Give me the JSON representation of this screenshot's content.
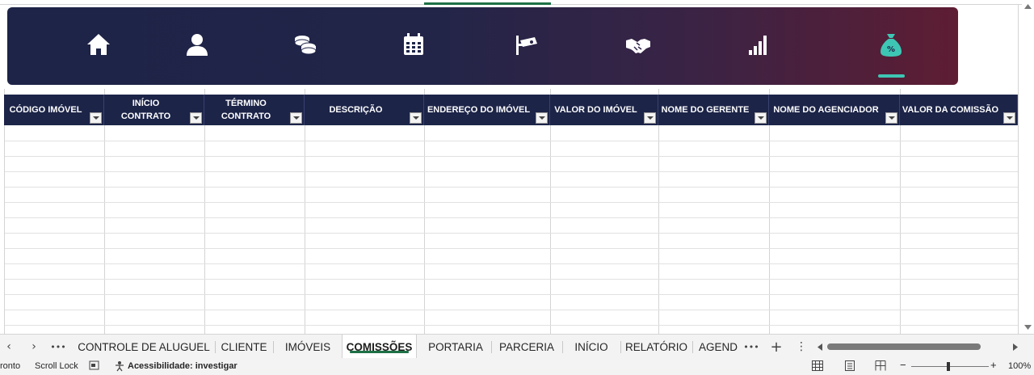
{
  "nav": {
    "items": [
      {
        "name": "home"
      },
      {
        "name": "cliente"
      },
      {
        "name": "moedas"
      },
      {
        "name": "agenda"
      },
      {
        "name": "portaria"
      },
      {
        "name": "parceria"
      },
      {
        "name": "relatorio"
      },
      {
        "name": "comissoes",
        "active": true
      }
    ],
    "accent": "#3ec6b4"
  },
  "table": {
    "headers": [
      {
        "l1": "CÓDIGO IMÓVEL",
        "l2": ""
      },
      {
        "l1": "INÍCIO",
        "l2": "CONTRATO"
      },
      {
        "l1": "TÉRMINO",
        "l2": "CONTRATO"
      },
      {
        "l1": "DESCRIÇÃO",
        "l2": ""
      },
      {
        "l1": "ENDEREÇO DO IMÓVEL",
        "l2": ""
      },
      {
        "l1": "VALOR DO IMÓVEL",
        "l2": ""
      },
      {
        "l1": "NOME DO GERENTE",
        "l2": ""
      },
      {
        "l1": "NOME DO AGENCIADOR",
        "l2": ""
      },
      {
        "l1": "VALOR DA COMISSÃO",
        "l2": ""
      }
    ],
    "header_bg": "#1c2448"
  },
  "tabs": {
    "overflow_left": "•••",
    "overflow_right": "•••",
    "add": "+",
    "more": "⋮",
    "items": [
      "CONTROLE DE ALUGUEL",
      "CLIENTE",
      "IMÓVEIS",
      "COMISSÕES",
      "PORTARIA",
      "PARCERIA",
      "INÍCIO",
      "RELATÓRIO",
      "AGEND"
    ],
    "active": "COMISSÕES"
  },
  "status": {
    "ready": "ronto",
    "scroll_lock": "Scroll Lock",
    "accessibility": "Acessibilidade: investigar",
    "zoom_minus": "−",
    "zoom_plus": "+",
    "zoom": "100%"
  }
}
